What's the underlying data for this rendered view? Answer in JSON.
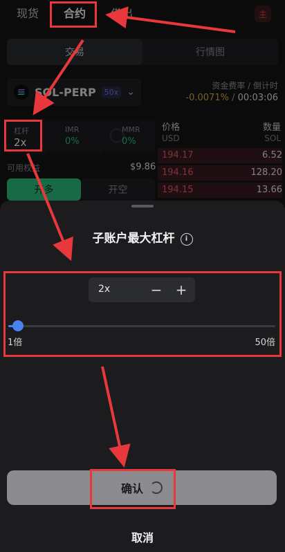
{
  "nav": {
    "tabs": [
      "现货",
      "合约",
      "借出"
    ],
    "main_label": "主"
  },
  "segment": {
    "trade": "交易",
    "market": "行情图"
  },
  "pair": {
    "name": "SOL-PERP",
    "leverage_badge": "50x"
  },
  "funding": {
    "label": "资金费率 / 倒计时",
    "rate": "-0.0071%",
    "separator": " / ",
    "countdown": "00:03:06"
  },
  "cards": {
    "leverage_label": "杠杆",
    "leverage_value": "2x",
    "imr_label": "IMR",
    "imr_value": "0%",
    "mmr_label": "MMR",
    "mmr_value": "0%"
  },
  "equity": {
    "label": "可用权益",
    "value": "$9.86"
  },
  "buttons": {
    "long": "开多",
    "short": "开空"
  },
  "orderbook": {
    "price_header": "价格",
    "qty_header": "数量",
    "price_unit": "USD",
    "qty_unit": "SOL",
    "rows": [
      {
        "price": "194.17",
        "qty": "6.52"
      },
      {
        "price": "194.16",
        "qty": "128.20"
      },
      {
        "price": "194.15",
        "qty": "13.66"
      }
    ]
  },
  "sheet": {
    "title": "子账户最大杠杆",
    "stepper_value": "2x",
    "minus": "−",
    "plus": "+",
    "slider_min": "1倍",
    "slider_max": "50倍",
    "slider_level": 0.02,
    "confirm": "确认",
    "cancel": "取消"
  },
  "colors": {
    "accent_blue": "#4b82f2",
    "buy_green": "#2cc07f",
    "sell_red": "#e65c64",
    "annotation_red": "#e8383b",
    "funding_rate": "#d8b33c"
  }
}
